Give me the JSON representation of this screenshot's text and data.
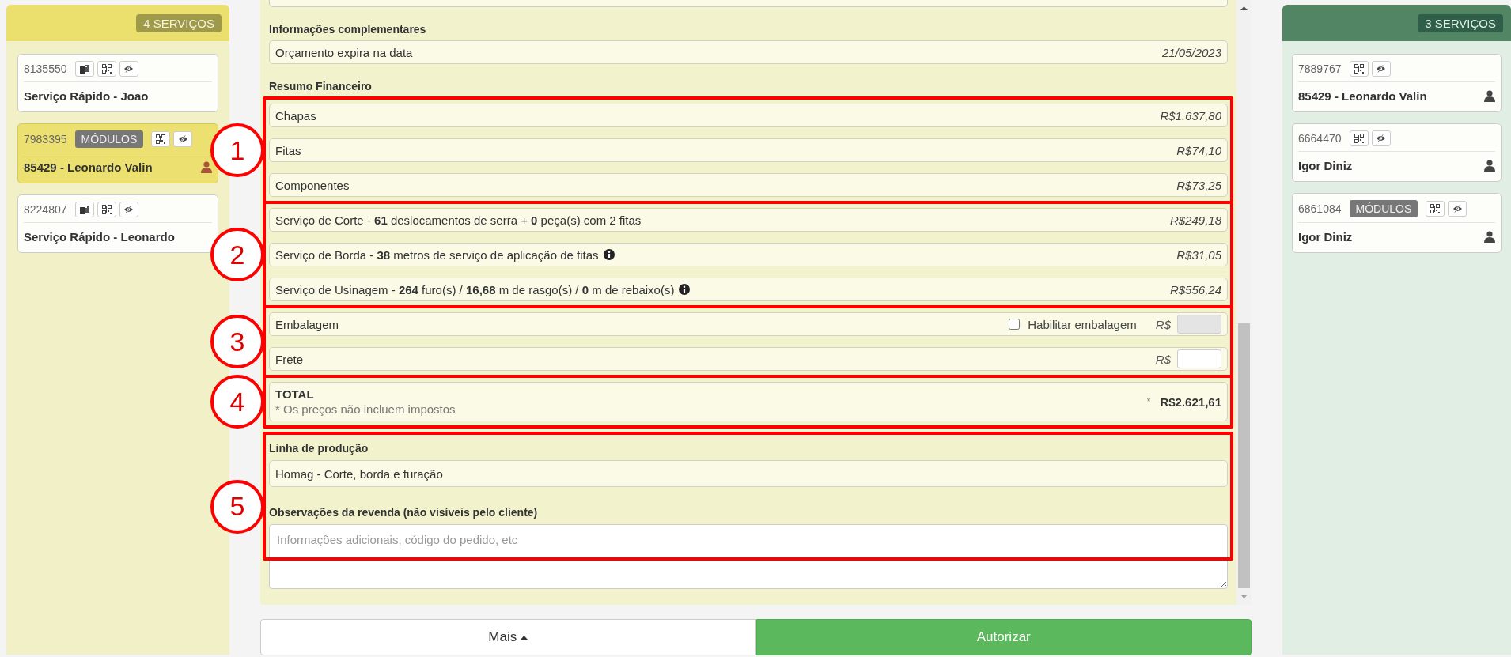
{
  "left_column": {
    "count_badge": "4 SERVIÇOS",
    "cards": [
      {
        "number": "8135550",
        "copy_action": true,
        "title": "Serviço Rápido - Joao",
        "assigned": false,
        "selected": false
      },
      {
        "number": "7983395",
        "badge": "MÓDULOS",
        "copy_action": false,
        "title": "85429 - Leonardo Valin",
        "assigned": true,
        "selected": true
      },
      {
        "number": "8224807",
        "copy_action": true,
        "title": "Serviço Rápido - Leonardo",
        "assigned": false,
        "selected": false
      }
    ]
  },
  "details": {
    "info_heading": "Informações complementares",
    "info_rows": [
      {
        "label": "Orçamento expira na data",
        "value": "21/05/2023"
      }
    ],
    "financial_heading": "Resumo Financeiro",
    "groups": [
      {
        "callout": "1",
        "rows": [
          {
            "kind": "price",
            "label": "Chapas",
            "value": "R$1.637,80",
            "info": false
          },
          {
            "kind": "price",
            "label": "Fitas",
            "value": "R$74,10",
            "info": false
          },
          {
            "kind": "price",
            "label": "Componentes",
            "value": "R$73,25",
            "info": false
          }
        ]
      },
      {
        "callout": "2",
        "rows": [
          {
            "kind": "price",
            "label": "Serviço de Corte - **61** deslocamentos de serra + **0** peça(s) com 2 fitas",
            "value": "R$249,18",
            "info": false
          },
          {
            "kind": "price",
            "label": "Serviço de Borda - **38** metros de serviço de aplicação de fitas",
            "value": "R$31,05",
            "info": true
          },
          {
            "kind": "price",
            "label": "Serviço de Usinagem - **264** furo(s) / **16,68** m de rasgo(s) / **0** m de rebaixo(s)",
            "value": "R$556,24",
            "info": true
          }
        ]
      },
      {
        "callout": "3",
        "rows": [
          {
            "kind": "input",
            "label": "Embalagem",
            "checkbox": {
              "label": "Habilitar embalagem",
              "checked": false
            },
            "currency": "R$",
            "disabled": true
          },
          {
            "kind": "input",
            "label": "Frete",
            "currency": "R$",
            "disabled": false
          }
        ]
      },
      {
        "callout": "4",
        "rows": [
          {
            "kind": "total",
            "label": "TOTAL",
            "note": "* Os preços não incluem impostos",
            "asterisk": "*",
            "value": "R$2.621,61"
          }
        ]
      }
    ],
    "production": {
      "callout": "5",
      "line_heading": "Linha de produção",
      "line_value": "Homag - Corte, borda e furação",
      "notes_heading": "Observações da revenda (não visíveis pelo cliente)",
      "notes_placeholder": "Informações adicionais, código do pedido, etc"
    }
  },
  "actions": [
    {
      "kind": "more",
      "label": "Mais"
    },
    {
      "kind": "primary",
      "label": "Autorizar"
    }
  ],
  "right_column": {
    "count_badge": "3 SERVIÇOS",
    "cards": [
      {
        "number": "7889767",
        "copy_action": false,
        "title": "85429 - Leonardo Valin",
        "assigned": true,
        "selected": false
      },
      {
        "number": "6664470",
        "copy_action": false,
        "title": "Igor Diniz",
        "assigned": true,
        "selected": false
      },
      {
        "number": "6861084",
        "badge": "MÓDULOS",
        "copy_action": false,
        "title": "Igor Diniz",
        "assigned": true,
        "selected": false
      }
    ]
  }
}
